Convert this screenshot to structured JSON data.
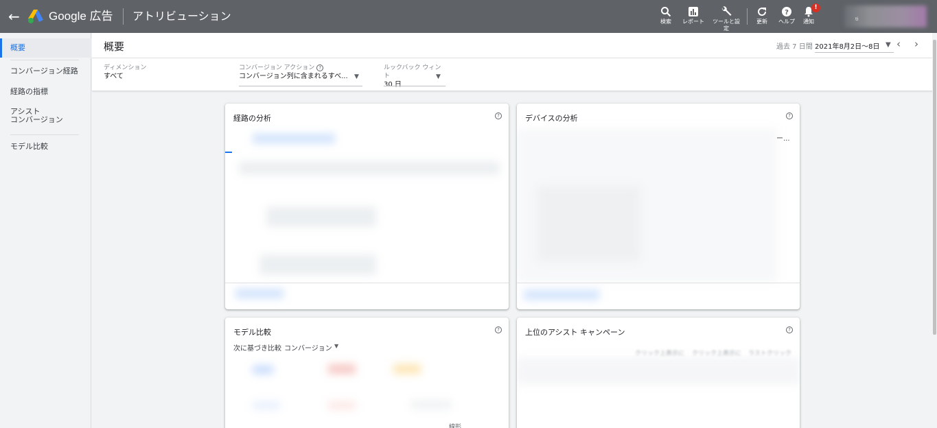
{
  "topbar": {
    "brand": "Google 広告",
    "app_title": "アトリビューション",
    "buttons": [
      {
        "label": "検索",
        "icon": "search-icon"
      },
      {
        "label": "レポート",
        "icon": "reports-icon"
      },
      {
        "label": "ツールと設定",
        "icon": "wrench-icon"
      },
      {
        "label": "更新",
        "icon": "refresh-icon"
      },
      {
        "label": "ヘルプ",
        "icon": "help-icon"
      },
      {
        "label": "通知",
        "icon": "bell-icon"
      }
    ],
    "notification_badge": "!",
    "account_partial": "ti"
  },
  "sidebar": {
    "items": [
      {
        "label": "概要"
      },
      {
        "label": "コンバージョン経路"
      },
      {
        "label": "経路の指標"
      },
      {
        "label": "アシスト\nコンバージョン"
      },
      {
        "label": "モデル比較"
      }
    ]
  },
  "header": {
    "title": "概要",
    "date_range_label": "過去 7 日間",
    "date_range_value": "2021年8月2日〜8日"
  },
  "filters": {
    "dimension_label": "ディメンション",
    "dimension_value": "すべて",
    "conversion_action_label": "コンバージョン アクション",
    "conversion_action_value": "コンバージョン列に含まれるすべ...",
    "lookback_label": "ルックバック ウィント",
    "lookback_value": "30 日"
  },
  "cards": {
    "path_analysis": {
      "title": "経路の分析"
    },
    "device_analysis": {
      "title": "デバイスの分析",
      "truncated": "ー..."
    },
    "model_comparison": {
      "title": "モデル比較",
      "compare_by_label": "次に基づき比較",
      "compare_by_value": "コンバージョン",
      "faint_text": "線形"
    },
    "top_assist": {
      "title": "上位のアシスト キャンペーン",
      "col_headers": [
        "クリック上表示に",
        "クリック上表示に",
        "ラストクリック"
      ]
    }
  },
  "colors": {
    "topbar": "#5f6368",
    "accent": "#1a73e8",
    "badge": "#d93025"
  }
}
